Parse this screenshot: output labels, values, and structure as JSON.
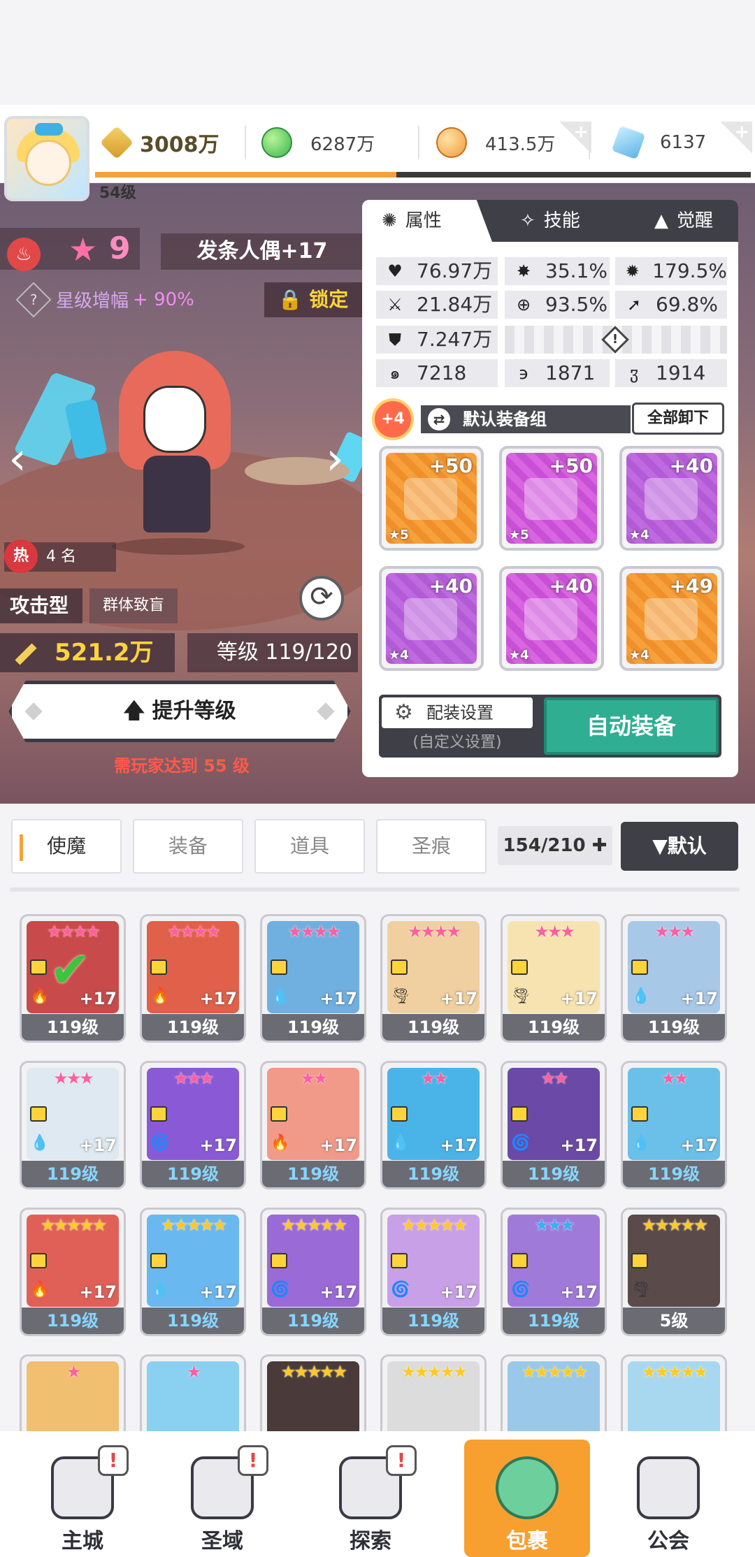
{
  "player": {
    "level": "54级"
  },
  "resources": {
    "power": "3008万",
    "green_coin": "6287万",
    "gold_coin": "413.5万",
    "diamond": "6137"
  },
  "hero": {
    "star": "9",
    "name": "发条人偶+17",
    "star_boost_label": "星级增幅",
    "star_boost_value": "+ 90%",
    "lock_label": "锁定",
    "hot_label": "热",
    "hot_rank": "4 名",
    "type": "攻击型",
    "type_sub": "群体致盲",
    "power": "521.2万",
    "level": "等级 119/120",
    "upgrade_label": "提升等级",
    "upgrade_tip": "需玩家达到 55 级",
    "refresh_icon": "refresh-icon"
  },
  "panel": {
    "tabs": [
      {
        "label": "属性",
        "icon": "attribute-icon"
      },
      {
        "label": "技能",
        "icon": "skill-icon"
      },
      {
        "label": "觉醒",
        "icon": "awaken-icon"
      }
    ],
    "stats": {
      "hp": "76.97万",
      "crit": "35.1%",
      "crit_dmg": "179.5%",
      "atk": "21.84万",
      "hit": "93.5%",
      "dodge": "69.8%",
      "def": "7.247万",
      "s1": "7218",
      "s2": "1871",
      "s3": "1914"
    },
    "equip_bonus": "+4",
    "equip_group": "默认装备组",
    "unload_all": "全部卸下",
    "equipment": [
      {
        "bonus": "+50",
        "stars": "★5",
        "quality": "orange"
      },
      {
        "bonus": "+50",
        "stars": "★5",
        "quality": "pink"
      },
      {
        "bonus": "+40",
        "stars": "★4",
        "quality": "purple"
      },
      {
        "bonus": "+40",
        "stars": "★4",
        "quality": "purple"
      },
      {
        "bonus": "+40",
        "stars": "★4",
        "quality": "pink"
      },
      {
        "bonus": "+49",
        "stars": "★4",
        "quality": "orange"
      }
    ],
    "config_label": "配装设置",
    "config_sub": "(自定义设置)",
    "auto_equip": "自动装备"
  },
  "filters": {
    "tabs": [
      "使魔",
      "装备",
      "道具",
      "圣痕"
    ],
    "count": "154/210 ✚",
    "sort": "▼默认"
  },
  "monsters": [
    {
      "stars": "★★★★",
      "star_color": "pink",
      "level": "119级",
      "plus": "+17",
      "elem": "🔥",
      "art": "#c84a4a",
      "checked": "✔"
    },
    {
      "stars": "★★★★",
      "star_color": "pink",
      "level": "119级",
      "plus": "+17",
      "elem": "🔥",
      "art": "#e0604a"
    },
    {
      "stars": "★★★★",
      "star_color": "pink",
      "level": "119级",
      "plus": "+17",
      "elem": "💧",
      "art": "#6fb0e0"
    },
    {
      "stars": "★★★★",
      "star_color": "pink",
      "level": "119级",
      "plus": "+17",
      "elem": "🌪",
      "art": "#f0d0a0"
    },
    {
      "stars": "★★★",
      "star_color": "pink",
      "level": "119级",
      "plus": "+17",
      "elem": "🌪",
      "art": "#f7e3b0"
    },
    {
      "stars": "★★★",
      "star_color": "pink",
      "level": "119级",
      "plus": "+17",
      "elem": "💧",
      "art": "#a8c8e8"
    },
    {
      "stars": "★★★",
      "star_color": "pink",
      "level": "119级",
      "plus": "+17",
      "elem": "💧",
      "art": "#dfe9f2",
      "lvl_blue": true
    },
    {
      "stars": "★★★",
      "star_color": "pink",
      "level": "119级",
      "plus": "+17",
      "elem": "🌀",
      "art": "#8a5ad6",
      "lvl_blue": true
    },
    {
      "stars": "★★",
      "star_color": "pink",
      "level": "119级",
      "plus": "+17",
      "elem": "🔥",
      "art": "#f29a8a",
      "lvl_blue": true
    },
    {
      "stars": "★★",
      "star_color": "pink",
      "level": "119级",
      "plus": "+17",
      "elem": "💧",
      "art": "#4ab4e8",
      "lvl_blue": true
    },
    {
      "stars": "★★",
      "star_color": "pink",
      "level": "119级",
      "plus": "+17",
      "elem": "🌀",
      "art": "#6a4aa6",
      "lvl_blue": true
    },
    {
      "stars": "★★",
      "star_color": "pink",
      "level": "119级",
      "plus": "+17",
      "elem": "💧",
      "art": "#6ac0e8",
      "lvl_blue": true
    },
    {
      "stars": "★★★★★",
      "star_color": "gold",
      "level": "119级",
      "plus": "+17",
      "elem": "🔥",
      "art": "#e06058",
      "lvl_blue": true
    },
    {
      "stars": "★★★★★",
      "star_color": "gold",
      "level": "119级",
      "plus": "+17",
      "elem": "💧",
      "art": "#6ab8f0",
      "lvl_blue": true
    },
    {
      "stars": "★★★★★",
      "star_color": "gold",
      "level": "119级",
      "plus": "+17",
      "elem": "🌀",
      "art": "#9a6ad6",
      "lvl_blue": true
    },
    {
      "stars": "★★★★★",
      "star_color": "gold",
      "level": "119级",
      "plus": "+17",
      "elem": "🌀",
      "art": "#c8a0e8",
      "lvl_blue": true
    },
    {
      "stars": "★★★",
      "star_color": "blue",
      "level": "119级",
      "plus": "+17",
      "elem": "🌀",
      "art": "#a07ad8",
      "lvl_blue": true
    },
    {
      "stars": "★★★★★",
      "star_color": "gold",
      "level": "5级",
      "plus": "",
      "elem": "🌪",
      "art": "#5a4a4a"
    },
    {
      "stars": "★",
      "star_color": "pink",
      "level": "",
      "plus": "",
      "elem": "",
      "art": "#f0c070"
    },
    {
      "stars": "★",
      "star_color": "pink",
      "level": "",
      "plus": "",
      "elem": "",
      "art": "#8ad0f0"
    },
    {
      "stars": "★★★★★",
      "star_color": "gold",
      "level": "",
      "plus": "",
      "elem": "",
      "art": "#4a3a3a"
    },
    {
      "stars": "★★★★★",
      "star_color": "gold",
      "level": "",
      "plus": "",
      "elem": "",
      "art": "#dcdcdc"
    },
    {
      "stars": "★★★★★",
      "star_color": "gold",
      "level": "",
      "plus": "",
      "elem": "",
      "art": "#9ac8e8"
    },
    {
      "stars": "★★★★★",
      "star_color": "gold",
      "level": "",
      "plus": "",
      "elem": "",
      "art": "#a8d8f0"
    }
  ],
  "nav": [
    {
      "label": "主城",
      "icon": "castle-icon",
      "alert": "!"
    },
    {
      "label": "圣域",
      "icon": "sanctuary-icon",
      "alert": "!"
    },
    {
      "label": "探索",
      "icon": "explore-icon",
      "alert": "!"
    },
    {
      "label": "包裹",
      "icon": "bag-icon",
      "alert": "",
      "active": true
    },
    {
      "label": "公会",
      "icon": "guild-icon",
      "alert": ""
    }
  ]
}
